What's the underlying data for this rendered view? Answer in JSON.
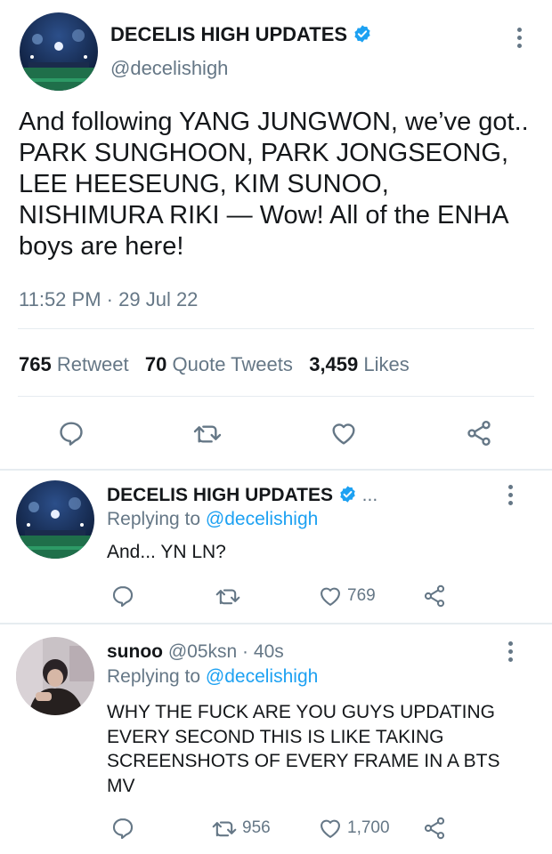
{
  "main_tweet": {
    "display_name": "DECELIS HIGH UPDATES",
    "handle": "@decelishigh",
    "text": "And following YANG JUNGWON, we’ve got.. PARK SUNGHOON, PARK JONGSEONG, LEE HEESEUNG, KIM SUNOO, NISHIMURA RIKI — Wow! All of the ENHA boys are here!",
    "time": "11:52 PM",
    "sep": "·",
    "date": "29 Jul 22",
    "stats": {
      "retweets": "765",
      "retweets_label": "Retweet",
      "quotes": "70",
      "quotes_label": "Quote Tweets",
      "likes": "3,459",
      "likes_label": "Likes"
    }
  },
  "replies": [
    {
      "display_name": "DECELIS HIGH UPDATES",
      "truncation": "...",
      "replying_label": "Replying to",
      "replying_to": "@decelishigh",
      "text": "And... YN LN?",
      "like_count": "769"
    },
    {
      "display_name": "sunoo",
      "handle": "@05ksn",
      "sep": "·",
      "age": "40s",
      "replying_label": "Replying to",
      "replying_to": "@decelishigh",
      "text": "WHY THE FUCK ARE YOU GUYS UPDATING EVERY SECOND THIS IS LIKE TAKING SCREENSHOTS OF EVERY FRAME IN A BTS MV",
      "retweet_count": "956",
      "like_count": "1,700"
    }
  ],
  "colors": {
    "accent": "#1da1f2",
    "muted": "#657786",
    "divider": "#e6ecf0",
    "text": "#14171a"
  },
  "icons": [
    "verified-badge-icon",
    "more-icon",
    "reply-icon",
    "retweet-icon",
    "like-icon",
    "share-icon"
  ]
}
